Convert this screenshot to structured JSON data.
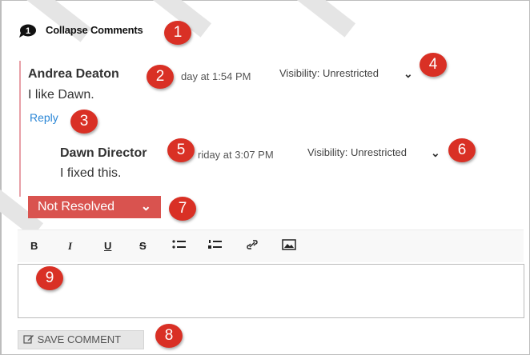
{
  "header": {
    "collapse_label": "Collapse Comments",
    "comment_count": "1"
  },
  "comments": [
    {
      "author": "Andrea Deaton",
      "timestamp": "day at 1:54 PM",
      "visibility": "Visibility: Unrestricted",
      "body": "I like Dawn.",
      "reply_label": "Reply"
    },
    {
      "author": "Dawn Director",
      "timestamp": "riday at 3:07 PM",
      "visibility": "Visibility: Unrestricted",
      "body": "I fixed this."
    }
  ],
  "status": {
    "label": "Not Resolved",
    "color": "#d9534f"
  },
  "toolbar": {
    "bold": "B",
    "italic": "I",
    "underline": "U",
    "strike": "S",
    "icons": [
      "bold-icon",
      "italic-icon",
      "underline-icon",
      "strikethrough-icon",
      "bulleted-list-icon",
      "numbered-list-icon",
      "link-icon",
      "image-icon"
    ]
  },
  "editor": {
    "value": ""
  },
  "save": {
    "label": "SAVE COMMENT",
    "icon": "edit-icon"
  },
  "markers": [
    "1",
    "2",
    "3",
    "4",
    "5",
    "6",
    "7",
    "8",
    "9"
  ],
  "colors": {
    "marker": "#d93025",
    "thread_line": "#e8a0a8",
    "link": "#2a86d6"
  }
}
